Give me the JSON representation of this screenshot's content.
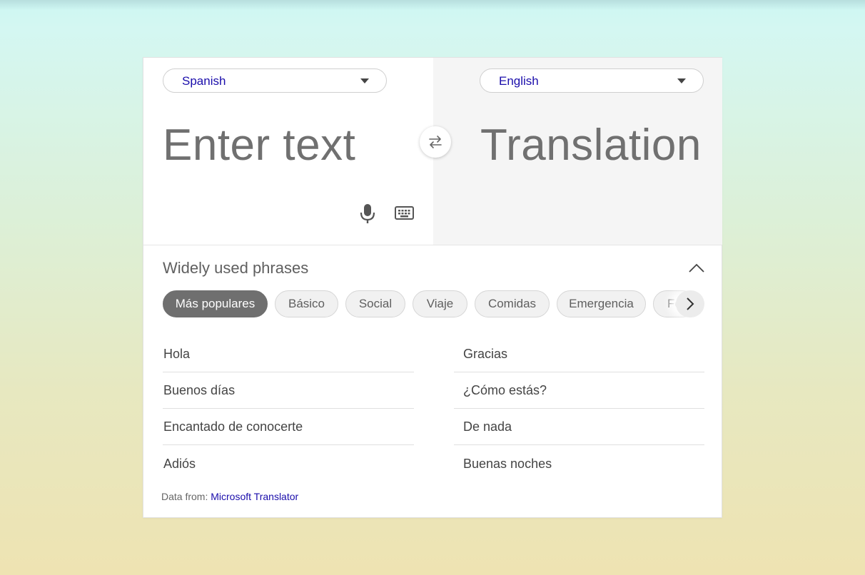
{
  "translator": {
    "source_language": "Spanish",
    "target_language": "English",
    "input_placeholder": "Enter text",
    "output_placeholder": "Translation"
  },
  "phrases": {
    "title": "Widely used phrases",
    "categories": [
      {
        "label": "Más populares",
        "active": true
      },
      {
        "label": "Básico",
        "active": false
      },
      {
        "label": "Social",
        "active": false
      },
      {
        "label": "Viaje",
        "active": false
      },
      {
        "label": "Comidas",
        "active": false
      },
      {
        "label": "Emergencia",
        "active": false
      },
      {
        "label": "Fe",
        "active": false
      }
    ],
    "left_column": [
      "Hola",
      "Buenos días",
      "Encantado de conocerte",
      "Adiós"
    ],
    "right_column": [
      "Gracias",
      "¿Cómo estás?",
      "De nada",
      "Buenas noches"
    ]
  },
  "footer": {
    "prefix": "Data from:",
    "link_text": "Microsoft Translator"
  },
  "icons": {
    "swap": "swap-arrows-icon",
    "mic": "microphone-icon",
    "keyboard": "keyboard-icon",
    "collapse": "chevron-up-icon",
    "next": "chevron-right-icon",
    "dropdown": "caret-down-icon"
  },
  "colors": {
    "link": "#1a0dab",
    "active_chip": "#6f6f6f",
    "placeholder": "#707070"
  }
}
